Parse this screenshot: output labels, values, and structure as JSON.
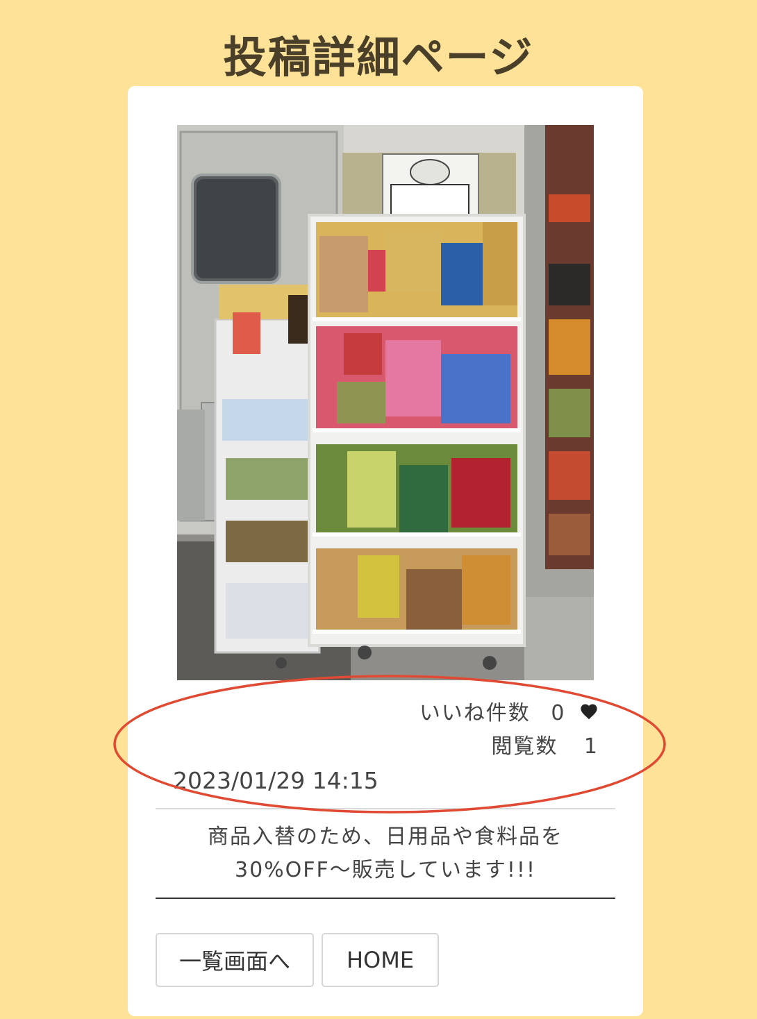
{
  "page": {
    "title": "投稿詳細ページ"
  },
  "post": {
    "image_alt": "商品棚の写真",
    "likes_label": "いいね件数",
    "likes_count": "0",
    "views_label": "閲覧数",
    "views_count": "1",
    "date": "2023/01/29 14:15",
    "description_line1": "商品入替のため、日用品や食料品を",
    "description_line2": "30%OFF〜販売しています!!!"
  },
  "buttons": {
    "list": "一覧画面へ",
    "home": "HOME"
  },
  "icons": {
    "like": "heart-icon"
  },
  "colors": {
    "background": "#fde297",
    "card": "#ffffff",
    "title": "#4a3f28",
    "annotation": "#e04a32"
  }
}
